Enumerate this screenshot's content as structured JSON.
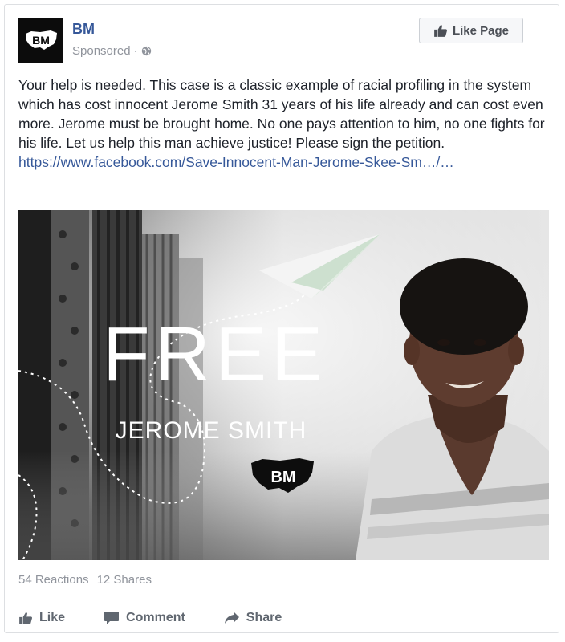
{
  "post": {
    "page_name": "BM",
    "sponsored": "Sponsored",
    "separator": "·",
    "like_page_label": "Like Page",
    "body_text": "Your help is needed. This case is a classic example of racial profiling in the system which has cost innocent Jerome Smith 31 years of his life already and can cost even more. Jerome must be brought home. No one pays attention to him, no one fights for his life. Let us help this man achieve justice! Please sign the petition.",
    "link_text": "https://www.facebook.com/Save-Innocent-Man-Jerome-Skee-Sm…/…",
    "avatar_text": "BM",
    "image": {
      "headline": "FREE",
      "subheadline": "JEROME SMITH",
      "logo_text": "BM"
    }
  },
  "stats": {
    "reactions": "54 Reactions",
    "shares": "12 Shares"
  },
  "actions": {
    "like": "Like",
    "comment": "Comment",
    "share": "Share"
  },
  "colors": {
    "link": "#365899",
    "secondary_text": "#90949c",
    "action_text": "#606770"
  },
  "icons": [
    "globe-icon",
    "thumbs-up-icon",
    "comment-icon",
    "share-arrow-icon",
    "paper-plane-icon"
  ]
}
